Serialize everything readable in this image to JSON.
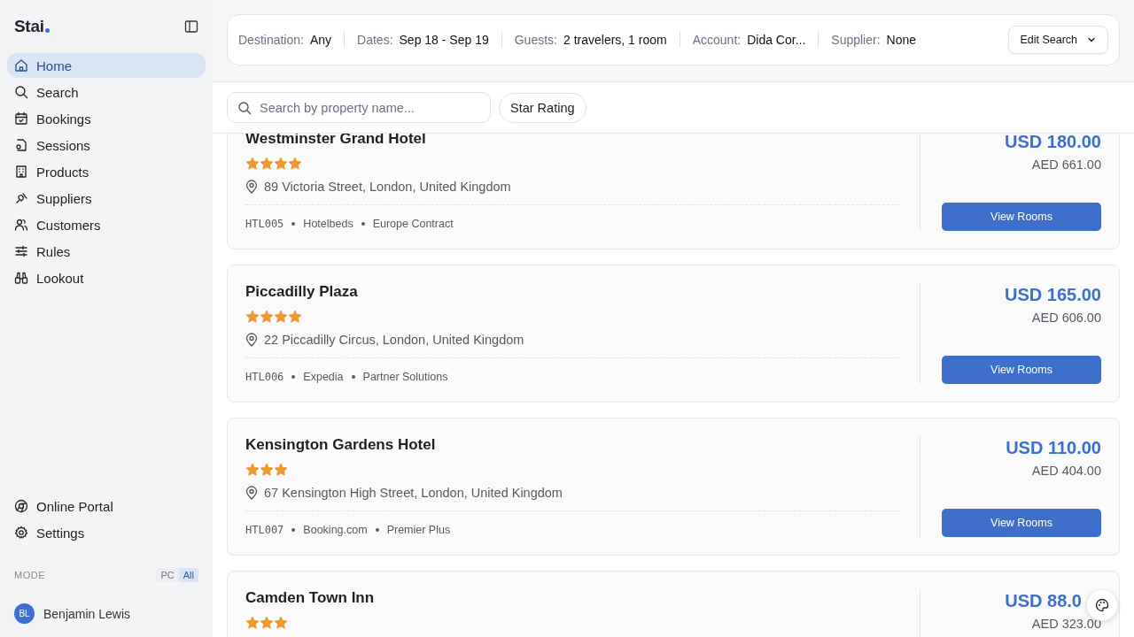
{
  "brand": {
    "name": "Stai"
  },
  "sidebar": {
    "items": [
      {
        "label": "Home",
        "selected": true
      },
      {
        "label": "Search",
        "selected": false
      },
      {
        "label": "Bookings",
        "selected": false
      },
      {
        "label": "Sessions",
        "selected": false
      },
      {
        "label": "Products",
        "selected": false
      },
      {
        "label": "Suppliers",
        "selected": false
      },
      {
        "label": "Customers",
        "selected": false
      },
      {
        "label": "Rules",
        "selected": false
      },
      {
        "label": "Lookout",
        "selected": false
      }
    ],
    "bottom_items": [
      {
        "label": "Online Portal",
        "selected": false
      },
      {
        "label": "Settings",
        "selected": false
      }
    ],
    "mode": {
      "label": "MODE",
      "options": [
        {
          "label": "PC",
          "selected": false
        },
        {
          "label": "All",
          "selected": true
        }
      ]
    },
    "user": {
      "initials": "BL",
      "name": "Benjamin Lewis"
    }
  },
  "search_summary": {
    "fields": [
      {
        "label": "Destination:",
        "value": "Any"
      },
      {
        "label": "Dates:",
        "value": "Sep 18 - Sep 19"
      },
      {
        "label": "Guests:",
        "value": "2 travelers, 1 room"
      },
      {
        "label": "Account:",
        "value": "Dida Cor..."
      },
      {
        "label": "Supplier:",
        "value": "None"
      }
    ],
    "button": "Edit Search"
  },
  "filters": {
    "search": {
      "placeholder": "Search by property name..."
    },
    "button": "Star Rating"
  },
  "hotels": [
    {
      "name": "Westminster Grand Hotel",
      "stars": 4,
      "address": "89 Victoria Street, London, United Kingdom",
      "code": "HTL005",
      "supplier": "Hotelbeds",
      "contract": "Europe Contract",
      "price": "USD 180.00",
      "alt_price": "AED 661.00",
      "button": "View Rooms"
    },
    {
      "name": "Piccadilly Plaza",
      "stars": 4,
      "address": "22 Piccadilly Circus, London, United Kingdom",
      "code": "HTL006",
      "supplier": "Expedia",
      "contract": "Partner Solutions",
      "price": "USD 165.00",
      "alt_price": "AED 606.00",
      "button": "View Rooms"
    },
    {
      "name": "Kensington Gardens Hotel",
      "stars": 3,
      "address": "67 Kensington High Street, London, United Kingdom",
      "code": "HTL007",
      "supplier": "Booking.com",
      "contract": "Premier Plus",
      "price": "USD 110.00",
      "alt_price": "AED 404.00",
      "button": "View Rooms"
    },
    {
      "name": "Camden Town Inn",
      "stars": 3,
      "price": "USD 88.0",
      "alt_price": "AED 323.00"
    }
  ]
}
